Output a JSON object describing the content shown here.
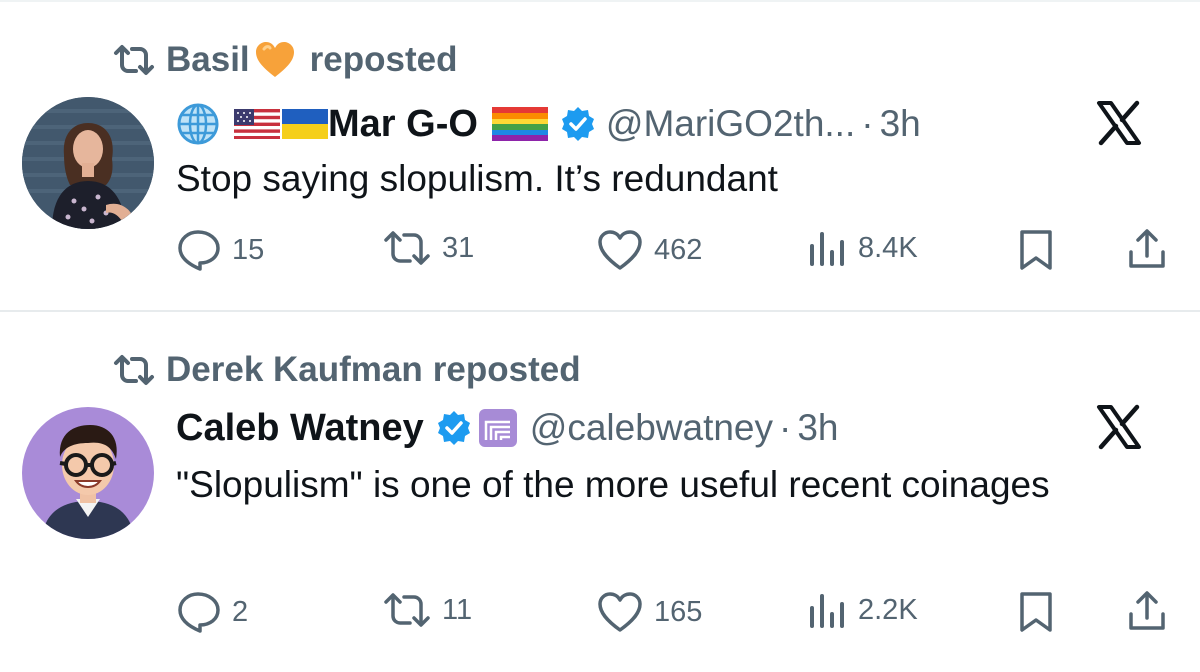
{
  "tweets": [
    {
      "reposter": "Basil",
      "repost_suffix": "reposted",
      "author_name": "Mar G-O",
      "handle": "@MariGO2th...",
      "separator": "·",
      "time": "3h",
      "text": "Stop saying slopulism. It’s redundant",
      "replies": "15",
      "reposts": "31",
      "likes": "462",
      "views": "8.4K",
      "icons": [
        "repost-icon",
        "orange-heart-icon",
        "globe-icon",
        "us-flag-icon",
        "ukraine-flag-icon",
        "rainbow-flag-icon",
        "verified-icon",
        "x-logo-icon",
        "reply-icon",
        "like-icon",
        "views-icon",
        "bookmark-icon",
        "share-icon"
      ]
    },
    {
      "reposter": "Derek Kaufman",
      "repost_suffix": "reposted",
      "author_name": "Caleb Watney",
      "handle": "@calebwatney",
      "separator": "·",
      "time": "3h",
      "text": "\"Slopulism\" is one of the more useful recent coinages",
      "replies": "2",
      "reposts": "11",
      "likes": "165",
      "views": "2.2K",
      "icons": [
        "repost-icon",
        "verified-icon",
        "affiliate-badge-icon",
        "x-logo-icon",
        "reply-icon",
        "like-icon",
        "views-icon",
        "bookmark-icon",
        "share-icon"
      ]
    }
  ],
  "colors": {
    "text_primary": "#0f1419",
    "text_secondary": "#536471",
    "verified_blue": "#1d9bf0",
    "divider": "#e7ebed"
  }
}
